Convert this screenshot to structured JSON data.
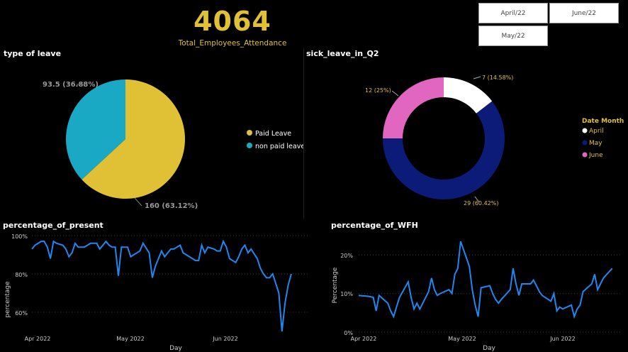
{
  "kpi": {
    "value": "4064",
    "label": "Total_Employees_Attendance"
  },
  "slicer": {
    "options": [
      "April/22",
      "June/22",
      "May/22"
    ]
  },
  "colors": {
    "accent": "#e0c035",
    "paid": "#e0c035",
    "nonpaid": "#1aa9c4",
    "april": "#ffffff",
    "may": "#0c1a78",
    "june": "#e066bf",
    "line": "#1e88f0"
  },
  "chart_data": [
    {
      "type": "pie",
      "title": "type of leave",
      "slices": [
        {
          "name": "Paid Leave",
          "value": 160,
          "label": "160 (63.12%)"
        },
        {
          "name": "non paid leave",
          "value": 93.5,
          "label": "93.5 (36.88%)"
        }
      ],
      "legend": [
        "Paid Leave",
        "non paid leave"
      ],
      "legend_position": "right"
    },
    {
      "type": "pie",
      "subtype": "donut",
      "title": "sick_leave_in_Q2",
      "slices": [
        {
          "name": "April",
          "value": 7,
          "label": "7 (14.58%)"
        },
        {
          "name": "May",
          "value": 29,
          "label": "29 (60.42%)"
        },
        {
          "name": "June",
          "value": 12,
          "label": "12 (25%)"
        }
      ],
      "legend_title": "Date Month",
      "legend": [
        "April",
        "May",
        "June"
      ],
      "legend_position": "right"
    },
    {
      "type": "line",
      "title": "percentage_of_present",
      "xlabel": "Day",
      "ylabel": "percentage",
      "x_ticks": [
        "Apr 2022",
        "May 2022",
        "Jun 2022"
      ],
      "y_ticks": [
        "100%",
        "80%",
        "60%"
      ],
      "ylim": [
        50,
        100
      ],
      "xlim": [
        "2022-04-01",
        "2022-06-30"
      ],
      "grid": true,
      "values": [
        93,
        95,
        97,
        97,
        94,
        88,
        97,
        96,
        95,
        93,
        89,
        91,
        96,
        94,
        94,
        95,
        96,
        96,
        96,
        93,
        97,
        95,
        94,
        94,
        79,
        94,
        94,
        89,
        90,
        91,
        92,
        96,
        91,
        78,
        84,
        88,
        92,
        89,
        93,
        93,
        94,
        95,
        91,
        90,
        88,
        87,
        87,
        95,
        91,
        94,
        93,
        92,
        92,
        97,
        94,
        88,
        86,
        89,
        93,
        95,
        91,
        93,
        88,
        83,
        80,
        78,
        78,
        80,
        70,
        50,
        65,
        74,
        80
      ],
      "dates": [
        "2022-04-01",
        "2022-04-02",
        "2022-04-04",
        "2022-04-05",
        "2022-04-06",
        "2022-04-07",
        "2022-04-08",
        "2022-04-09",
        "2022-04-11",
        "2022-04-12",
        "2022-04-13",
        "2022-04-14",
        "2022-04-15",
        "2022-04-16",
        "2022-04-18",
        "2022-04-19",
        "2022-04-20",
        "2022-04-21",
        "2022-04-22",
        "2022-04-23",
        "2022-04-25",
        "2022-04-26",
        "2022-04-27",
        "2022-04-28",
        "2022-04-29",
        "2022-04-30",
        "2022-05-02",
        "2022-05-03",
        "2022-05-04",
        "2022-05-05",
        "2022-05-06",
        "2022-05-07",
        "2022-05-09",
        "2022-05-10",
        "2022-05-11",
        "2022-05-12",
        "2022-05-13",
        "2022-05-14",
        "2022-05-16",
        "2022-05-17",
        "2022-05-18",
        "2022-05-19",
        "2022-05-20",
        "2022-05-21",
        "2022-05-23",
        "2022-05-24",
        "2022-05-25",
        "2022-05-26",
        "2022-05-27",
        "2022-05-28",
        "2022-05-30",
        "2022-05-31",
        "2022-06-01",
        "2022-06-02",
        "2022-06-03",
        "2022-06-04",
        "2022-06-06",
        "2022-06-07",
        "2022-06-08",
        "2022-06-09",
        "2022-06-10",
        "2022-06-11",
        "2022-06-13",
        "2022-06-14",
        "2022-06-15",
        "2022-06-16",
        "2022-06-17",
        "2022-06-18",
        "2022-06-20",
        "2022-06-21",
        "2022-06-22",
        "2022-06-23",
        "2022-06-24"
      ]
    },
    {
      "type": "line",
      "title": "percentage_of_WFH",
      "xlabel": "Day",
      "ylabel": "Percentage",
      "x_ticks": [
        "Apr 2022",
        "May 2022",
        "Jun 2022"
      ],
      "y_ticks": [
        "20%",
        "10%",
        "0%"
      ],
      "ylim": [
        0,
        25
      ],
      "xlim": [
        "2022-04-01",
        "2022-06-30"
      ],
      "grid": true,
      "values": [
        9.5,
        9.3,
        9.2,
        9.0,
        5.5,
        9.5,
        7.5,
        5.5,
        4,
        6.5,
        9,
        13,
        9,
        6,
        7.5,
        6,
        10.5,
        14,
        11,
        9.5,
        10,
        11,
        10,
        15,
        16.5,
        23.5,
        17,
        11,
        7,
        4,
        11.5,
        12,
        10,
        8.5,
        7.5,
        8.5,
        11,
        16.5,
        12.5,
        9.5,
        12.5,
        12.5,
        13.5,
        12,
        10.5,
        9.5,
        8,
        10,
        5.5,
        6.5,
        6,
        7,
        4,
        6,
        7,
        10.5,
        12.5,
        15,
        11,
        12.5,
        14,
        16.5
      ],
      "dates": [
        "2022-04-01",
        "2022-04-04",
        "2022-04-05",
        "2022-04-06",
        "2022-04-07",
        "2022-04-08",
        "2022-04-11",
        "2022-04-12",
        "2022-04-13",
        "2022-04-14",
        "2022-04-15",
        "2022-04-18",
        "2022-04-19",
        "2022-04-20",
        "2022-04-21",
        "2022-04-22",
        "2022-04-25",
        "2022-04-26",
        "2022-04-27",
        "2022-04-28",
        "2022-04-29",
        "2022-05-02",
        "2022-05-03",
        "2022-05-04",
        "2022-05-05",
        "2022-05-06",
        "2022-05-09",
        "2022-05-10",
        "2022-05-11",
        "2022-05-12",
        "2022-05-13",
        "2022-05-16",
        "2022-05-17",
        "2022-05-18",
        "2022-05-19",
        "2022-05-20",
        "2022-05-23",
        "2022-05-24",
        "2022-05-25",
        "2022-05-26",
        "2022-05-27",
        "2022-05-30",
        "2022-05-31",
        "2022-06-01",
        "2022-06-02",
        "2022-06-03",
        "2022-06-06",
        "2022-06-07",
        "2022-06-08",
        "2022-06-09",
        "2022-06-10",
        "2022-06-13",
        "2022-06-14",
        "2022-06-15",
        "2022-06-16",
        "2022-06-17",
        "2022-06-20",
        "2022-06-21",
        "2022-06-22",
        "2022-06-23",
        "2022-06-24",
        "2022-06-27"
      ]
    }
  ]
}
